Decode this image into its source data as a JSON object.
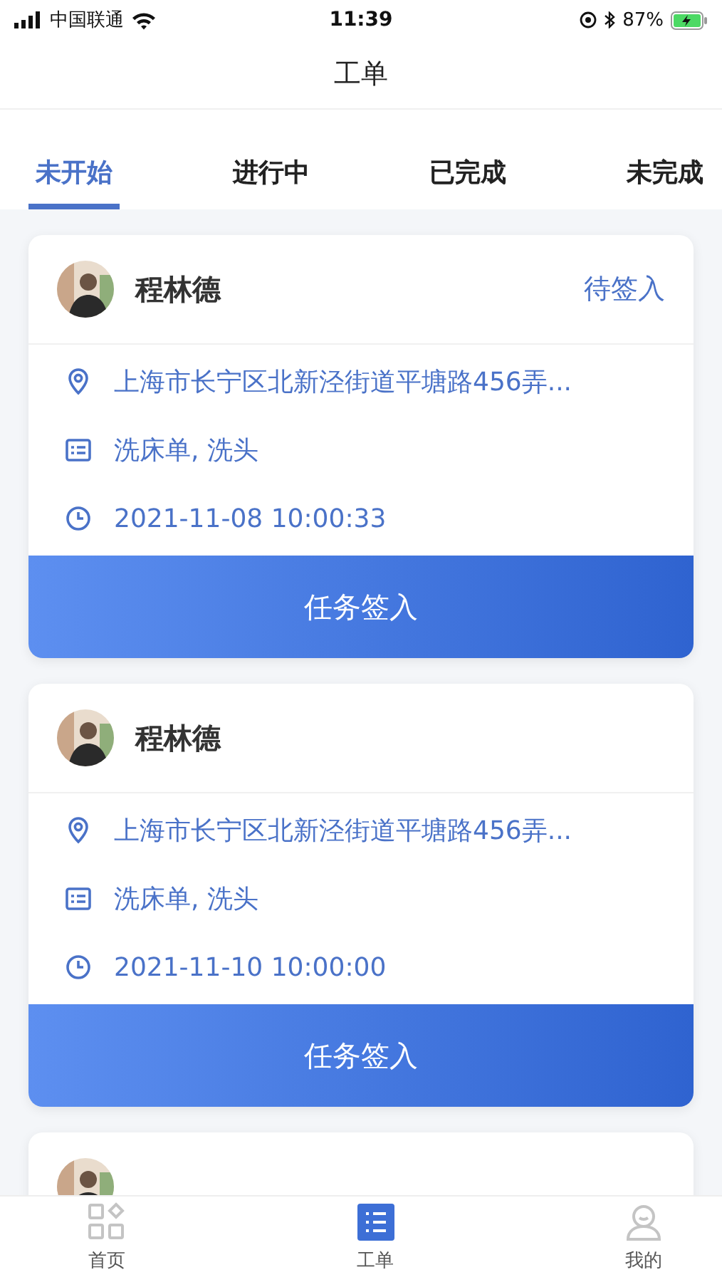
{
  "status_bar": {
    "carrier": "中国联通",
    "time": "11:39",
    "battery": "87%"
  },
  "title": "工单",
  "tabs": [
    {
      "label": "未开始",
      "selected": true
    },
    {
      "label": "进行中",
      "selected": false
    },
    {
      "label": "已完成",
      "selected": false
    },
    {
      "label": "未完成",
      "selected": false
    }
  ],
  "orders": [
    {
      "avatar": {
        "kind": "picture"
      },
      "name": "程林德",
      "status": "待签入",
      "address": "上海市长宁区北新泾街道平塘路456弄...",
      "services": "洗床单, 洗头",
      "time": "2021-11-08 10:00:33",
      "action": "任务签入"
    },
    {
      "avatar": {
        "kind": "picture"
      },
      "name": "程林德",
      "address": "上海市长宁区北新泾街道平塘路456弄...",
      "services": "洗床单, 洗头",
      "time": "2021-11-10 10:00:00",
      "action": "任务签入"
    },
    {
      "avatar": {
        "kind": "picture"
      }
    }
  ],
  "bottom_nav": [
    {
      "label": "首页",
      "kind": "grid",
      "selected": false
    },
    {
      "label": "工单",
      "kind": "list",
      "selected": true
    },
    {
      "label": "我的",
      "kind": "person",
      "selected": false
    }
  ]
}
